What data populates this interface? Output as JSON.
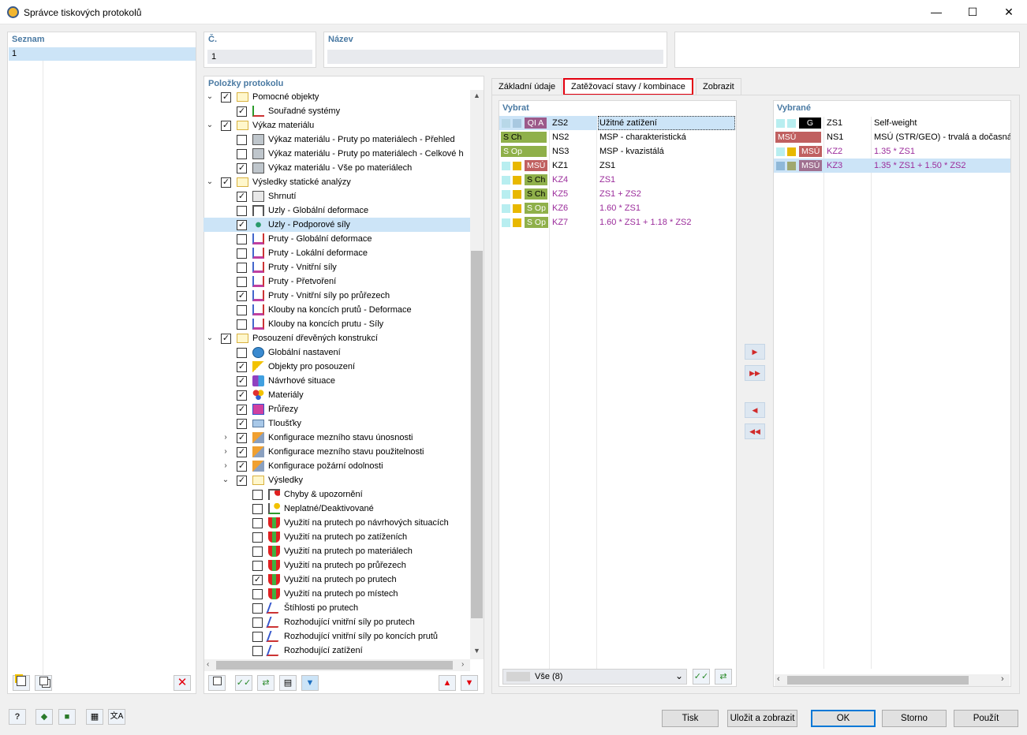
{
  "window": {
    "title": "Správce tiskových protokolů",
    "minimize": "—",
    "maximize": "☐",
    "close": "✕"
  },
  "seznam": {
    "header": "Seznam",
    "items": [
      "1"
    ]
  },
  "cislo": {
    "label": "Č.",
    "value": "1"
  },
  "nazev": {
    "label": "Název",
    "value": ""
  },
  "tree": {
    "header": "Položky protokolu",
    "rows": [
      {
        "lvl": 0,
        "exp": "⌄",
        "cb": "✓",
        "icon": "folder-icon",
        "label": "Pomocné objekty"
      },
      {
        "lvl": 1,
        "exp": "",
        "cb": "✓",
        "icon": "coordinate-system-icon",
        "label": "Souřadné systémy"
      },
      {
        "lvl": 0,
        "exp": "⌄",
        "cb": "✓",
        "icon": "folder-icon",
        "label": "Výkaz materiálu"
      },
      {
        "lvl": 1,
        "exp": "",
        "cb": "",
        "icon": "material-report-icon",
        "label": "Výkaz materiálu - Pruty po materiálech - Přehled"
      },
      {
        "lvl": 1,
        "exp": "",
        "cb": "",
        "icon": "material-report-icon",
        "label": "Výkaz materiálu - Pruty po materiálech - Celkové h"
      },
      {
        "lvl": 1,
        "exp": "",
        "cb": "✓",
        "icon": "material-report-icon",
        "label": "Výkaz materiálu - Vše po materiálech"
      },
      {
        "lvl": 0,
        "exp": "⌄",
        "cb": "✓",
        "icon": "folder-icon",
        "label": "Výsledky statické analýzy"
      },
      {
        "lvl": 1,
        "exp": "",
        "cb": "✓",
        "icon": "summary-icon",
        "label": "Shrnutí"
      },
      {
        "lvl": 1,
        "exp": "",
        "cb": "",
        "icon": "node-deformation-icon",
        "label": "Uzly - Globální deformace"
      },
      {
        "lvl": 1,
        "exp": "",
        "cb": "✓",
        "icon": "support-forces-icon",
        "label": "Uzly - Podporové síly",
        "sel": true
      },
      {
        "lvl": 1,
        "exp": "",
        "cb": "",
        "icon": "member-result-icon",
        "label": "Pruty - Globální deformace"
      },
      {
        "lvl": 1,
        "exp": "",
        "cb": "",
        "icon": "member-result-icon",
        "label": "Pruty - Lokální deformace"
      },
      {
        "lvl": 1,
        "exp": "",
        "cb": "",
        "icon": "member-result-icon",
        "label": "Pruty - Vnitřní síly"
      },
      {
        "lvl": 1,
        "exp": "",
        "cb": "",
        "icon": "member-result-icon",
        "label": "Pruty - Přetvoření"
      },
      {
        "lvl": 1,
        "exp": "",
        "cb": "✓",
        "icon": "member-result-icon",
        "label": "Pruty - Vnitřní síly po průřezech"
      },
      {
        "lvl": 1,
        "exp": "",
        "cb": "",
        "icon": "member-result-icon",
        "label": "Klouby na koncích prutů - Deformace"
      },
      {
        "lvl": 1,
        "exp": "",
        "cb": "",
        "icon": "member-result-icon",
        "label": "Klouby na koncích prutu - Síly"
      },
      {
        "lvl": 0,
        "exp": "⌄",
        "cb": "✓",
        "icon": "folder-icon",
        "label": "Posouzení dřevěných konstrukcí"
      },
      {
        "lvl": 1,
        "exp": "",
        "cb": "",
        "icon": "globe-icon",
        "label": "Globální nastavení"
      },
      {
        "lvl": 1,
        "exp": "",
        "cb": "✓",
        "icon": "design-objects-icon",
        "label": "Objekty pro posouzení"
      },
      {
        "lvl": 1,
        "exp": "",
        "cb": "✓",
        "icon": "design-situations-icon",
        "label": "Návrhové situace"
      },
      {
        "lvl": 1,
        "exp": "",
        "cb": "✓",
        "icon": "materials-icon",
        "label": "Materiály"
      },
      {
        "lvl": 1,
        "exp": "",
        "cb": "✓",
        "icon": "cross-sections-icon",
        "label": "Průřezy"
      },
      {
        "lvl": 1,
        "exp": "",
        "cb": "✓",
        "icon": "thickness-icon",
        "label": "Tloušťky"
      },
      {
        "lvl": 1,
        "exp": "›",
        "cb": "✓",
        "icon": "configuration-icon",
        "label": "Konfigurace mezního stavu únosnosti"
      },
      {
        "lvl": 1,
        "exp": "›",
        "cb": "✓",
        "icon": "configuration-icon",
        "label": "Konfigurace mezního stavu použitelnosti"
      },
      {
        "lvl": 1,
        "exp": "›",
        "cb": "✓",
        "icon": "configuration-icon",
        "label": "Konfigurace požární odolnosti"
      },
      {
        "lvl": 1,
        "exp": "⌄",
        "cb": "✓",
        "icon": "folder-icon",
        "label": "Výsledky"
      },
      {
        "lvl": 2,
        "exp": "",
        "cb": "",
        "icon": "errors-warnings-icon",
        "label": "Chyby & upozornění"
      },
      {
        "lvl": 2,
        "exp": "",
        "cb": "",
        "icon": "invalid-deactivated-icon",
        "label": "Neplatné/Deaktivované"
      },
      {
        "lvl": 2,
        "exp": "",
        "cb": "",
        "icon": "utilization-icon",
        "label": "Využití na prutech po návrhových situacích"
      },
      {
        "lvl": 2,
        "exp": "",
        "cb": "",
        "icon": "utilization-icon",
        "label": "Využití na prutech po zatíženích"
      },
      {
        "lvl": 2,
        "exp": "",
        "cb": "",
        "icon": "utilization-icon",
        "label": "Využití na prutech po materiálech"
      },
      {
        "lvl": 2,
        "exp": "",
        "cb": "",
        "icon": "utilization-icon",
        "label": "Využití na prutech po průřezech"
      },
      {
        "lvl": 2,
        "exp": "",
        "cb": "✓",
        "icon": "utilization-icon",
        "label": "Využití na prutech po prutech"
      },
      {
        "lvl": 2,
        "exp": "",
        "cb": "",
        "icon": "utilization-icon",
        "label": "Využití na prutech po místech"
      },
      {
        "lvl": 2,
        "exp": "",
        "cb": "",
        "icon": "slenderness-icon",
        "label": "Štíhlosti po prutech"
      },
      {
        "lvl": 2,
        "exp": "",
        "cb": "",
        "icon": "slenderness-icon",
        "label": "Rozhodující vnitřní síly po prutech"
      },
      {
        "lvl": 2,
        "exp": "",
        "cb": "",
        "icon": "slenderness-icon",
        "label": "Rozhodující vnitřní síly po koncích prutů"
      },
      {
        "lvl": 2,
        "exp": "",
        "cb": "",
        "icon": "slenderness-icon",
        "label": "Rozhodující zatížení"
      }
    ]
  },
  "tabs": [
    "Základní údaje",
    "Zatěžovací stavy / kombinace",
    "Zobrazit"
  ],
  "vybrat": {
    "header": "Vybrat",
    "rows": [
      {
        "c1": "#b8d8e8",
        "c2": "#a8c8e0",
        "tag": "QI A",
        "tagbg": "#9c5a8a",
        "tagfg": "#fff",
        "id": "ZS2",
        "desc": "Užitné zatížení",
        "purple": false,
        "sel": true
      },
      {
        "c1": "",
        "c2": "",
        "tag": "S Ch",
        "tagbg": "#8fb04a",
        "tagfg": "#000",
        "id": "NS2",
        "desc": "MSP - charakteristická",
        "purple": false,
        "wide": true
      },
      {
        "c1": "",
        "c2": "",
        "tag": "S Op",
        "tagbg": "#8fb04a",
        "tagfg": "#fff",
        "id": "NS3",
        "desc": "MSP - kvazistálá",
        "purple": false,
        "wide": true
      },
      {
        "c1": "#b8eef0",
        "c2": "#e8b800",
        "tag": "MSÚ",
        "tagbg": "#c06060",
        "tagfg": "#fff",
        "id": "KZ1",
        "desc": "ZS1",
        "purple": false
      },
      {
        "c1": "#b8eef0",
        "c2": "#e8b800",
        "tag": "S Ch",
        "tagbg": "#8fb04a",
        "tagfg": "#000",
        "id": "KZ4",
        "desc": "ZS1",
        "purple": true
      },
      {
        "c1": "#b8eef0",
        "c2": "#e8b800",
        "tag": "S Ch",
        "tagbg": "#8fb04a",
        "tagfg": "#000",
        "id": "KZ5",
        "desc": "ZS1 + ZS2",
        "purple": true
      },
      {
        "c1": "#b8eef0",
        "c2": "#e8b800",
        "tag": "S Op",
        "tagbg": "#8fb04a",
        "tagfg": "#fff",
        "id": "KZ6",
        "desc": "1.60 * ZS1",
        "purple": true
      },
      {
        "c1": "#b8eef0",
        "c2": "#e8b800",
        "tag": "S Op",
        "tagbg": "#8fb04a",
        "tagfg": "#fff",
        "id": "KZ7",
        "desc": "1.60 * ZS1 + 1.18 * ZS2",
        "purple": true
      }
    ],
    "filter": "Vše (8)"
  },
  "vybrane": {
    "header": "Vybrané",
    "rows": [
      {
        "c1": "#b8eef0",
        "c2": "#b8eef0",
        "tag": "G",
        "tagbg": "#000",
        "tagfg": "#fff",
        "id": "ZS1",
        "desc": "Self-weight",
        "purple": false
      },
      {
        "c1": "",
        "c2": "",
        "tag": "MSÚ",
        "tagbg": "#c06060",
        "tagfg": "#fff",
        "id": "NS1",
        "desc": "MSÚ (STR/GEO) - trvalá a dočasná",
        "purple": false,
        "wide": true
      },
      {
        "c1": "#b8eef0",
        "c2": "#e8b800",
        "tag": "MSÚ",
        "tagbg": "#c06060",
        "tagfg": "#fff",
        "id": "KZ2",
        "desc": "1.35 * ZS1",
        "purple": true
      },
      {
        "c1": "#8fb8d8",
        "c2": "#a0a870",
        "tag": "MSÚ",
        "tagbg": "#a07090",
        "tagfg": "#fff",
        "id": "KZ3",
        "desc": "1.35 * ZS1 + 1.50 * ZS2",
        "purple": true,
        "sel": true
      }
    ]
  },
  "arrows": {
    "add_one": "▶",
    "add_all": "▶▶",
    "remove_one": "◀",
    "remove_all": "◀◀"
  },
  "buttons": {
    "print": "Tisk",
    "save_view": "Uložit a zobrazit",
    "ok": "OK",
    "cancel": "Storno",
    "apply": "Použít"
  },
  "colors": {
    "accent": "#0078d7",
    "header": "#4a7aa3",
    "selection": "#cce4f7",
    "tab_highlight": "#e3000f",
    "purple_text": "#9b2c9b"
  }
}
